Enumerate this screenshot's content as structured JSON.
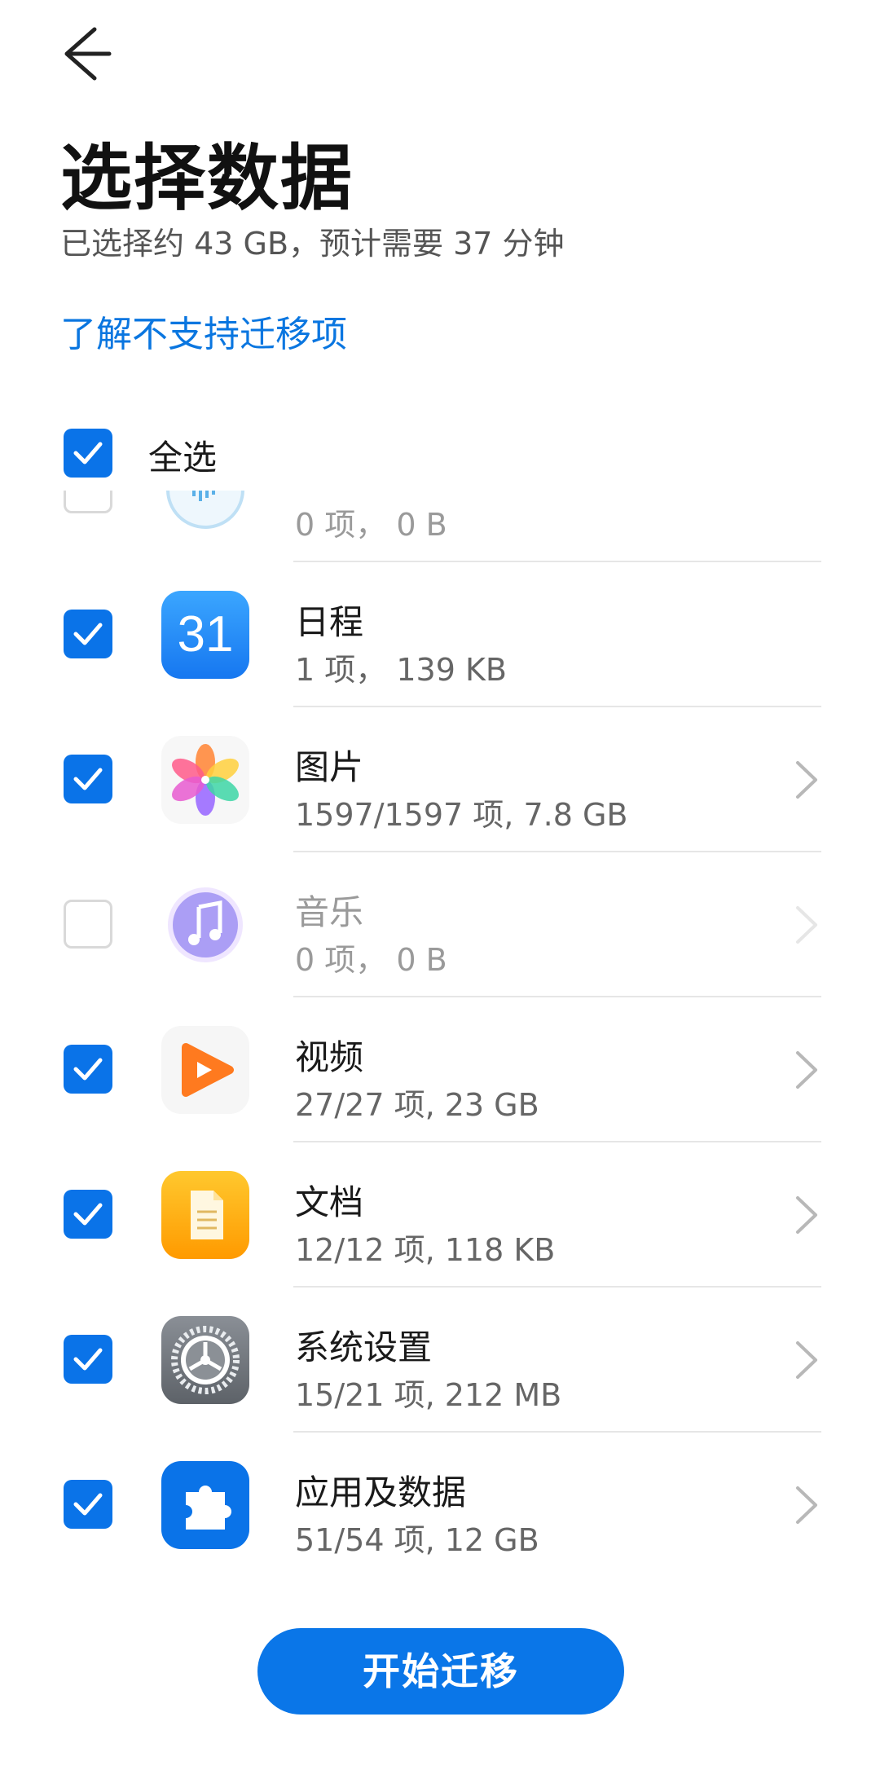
{
  "header": {
    "back_icon": "arrow-left-icon",
    "title": "选择数据",
    "subtitle": "已选择约 43 GB，预计需要 37 分钟",
    "link": "了解不支持迁移项"
  },
  "select_all": {
    "label": "全选",
    "checked": true
  },
  "items": [
    {
      "name": "",
      "meta": "0 项， 0 B",
      "checked": false,
      "icon": "voice-recorder-icon",
      "has_detail": false,
      "disabled": true
    },
    {
      "name": "日程",
      "meta": "1 项， 139 KB",
      "checked": true,
      "icon": "calendar-icon",
      "icon_text": "31",
      "has_detail": false,
      "disabled": false
    },
    {
      "name": "图片",
      "meta": "1597/1597 项, 7.8 GB",
      "checked": true,
      "icon": "gallery-icon",
      "has_detail": true,
      "disabled": false
    },
    {
      "name": "音乐",
      "meta": "0 项， 0 B",
      "checked": false,
      "icon": "music-icon",
      "has_detail": true,
      "disabled": true
    },
    {
      "name": "视频",
      "meta": "27/27 项, 23 GB",
      "checked": true,
      "icon": "video-icon",
      "has_detail": true,
      "disabled": false
    },
    {
      "name": "文档",
      "meta": "12/12 项, 118 KB",
      "checked": true,
      "icon": "document-icon",
      "has_detail": true,
      "disabled": false
    },
    {
      "name": "系统设置",
      "meta": "15/21 项, 212 MB",
      "checked": true,
      "icon": "settings-icon",
      "has_detail": true,
      "disabled": false
    },
    {
      "name": "应用及数据",
      "meta": "51/54 项, 12 GB",
      "checked": true,
      "icon": "apps-data-icon",
      "has_detail": true,
      "disabled": false
    }
  ],
  "start_button": {
    "label": "开始迁移"
  },
  "colors": {
    "accent": "#0a73e8",
    "link": "#0a76e0"
  }
}
